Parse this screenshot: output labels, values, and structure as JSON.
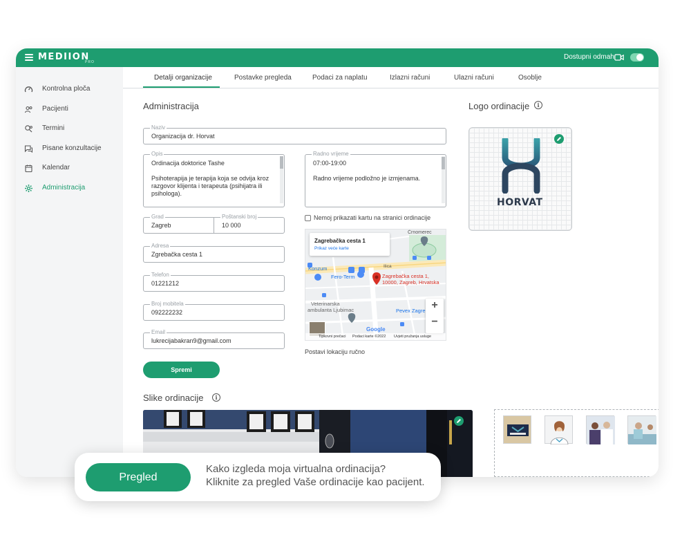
{
  "app": {
    "brand": "MEDIION",
    "brand_sub": "PRO",
    "availability_label": "Dostupni odmah",
    "availability_on": true,
    "accent_color": "#1e9d70"
  },
  "sidebar": {
    "items": [
      {
        "label": "Kontrolna ploča",
        "icon": "dashboard-icon"
      },
      {
        "label": "Pacijenti",
        "icon": "patients-icon"
      },
      {
        "label": "Termini",
        "icon": "appointments-icon"
      },
      {
        "label": "Pisane konzultacije",
        "icon": "chat-icon"
      },
      {
        "label": "Kalendar",
        "icon": "calendar-icon"
      },
      {
        "label": "Administracija",
        "icon": "gear-icon",
        "active": true
      }
    ]
  },
  "tabs": [
    {
      "label": "Detalji organizacije",
      "active": true
    },
    {
      "label": "Postavke pregleda"
    },
    {
      "label": "Podaci za naplatu"
    },
    {
      "label": "Izlazni računi"
    },
    {
      "label": "Ulazni računi"
    },
    {
      "label": "Osoblje"
    }
  ],
  "admin": {
    "title": "Administracija",
    "name": {
      "label": "Naziv",
      "value": "Organizacija dr. Horvat"
    },
    "description": {
      "label": "Opis",
      "line1": "Ordinacija doktorice Tashe",
      "line2": "Psihoterapija je terapija koja se odvija kroz razgovor klijenta i terapeuta (psihijatra ili psihologa)."
    },
    "hours": {
      "label": "Radno vrijeme",
      "line1": "07:00-19:00",
      "line2": "Radno vrijeme podložno je izmjenama."
    },
    "city": {
      "label": "Grad",
      "value": "Zagreb"
    },
    "postal": {
      "label": "Poštanski broj",
      "value": "10 000"
    },
    "address": {
      "label": "Adresa",
      "value": "Zgrebačka cesta 1"
    },
    "phone": {
      "label": "Telefon",
      "value": "01221212"
    },
    "mobile": {
      "label": "Broj mobitela",
      "value": "092222232"
    },
    "email": {
      "label": "Email",
      "value": "lukrecijabakran9@gmail.com"
    },
    "hide_map_label": "Nemoj prikazati kartu na stranici ordinacije",
    "hide_map_checked": false,
    "save_label": "Spremi",
    "set_location_label": "Postavi lokaciju ručno"
  },
  "map": {
    "card_address": "Zagrebačka cesta 1",
    "card_link": "Prikaz veće karte",
    "pin_line1": "Zagrebačka cesta 1,",
    "pin_line2": "10000, Zagreb, Hrvatska",
    "places": [
      "Konzum",
      "Fero-Term",
      "Veterinarska",
      "ambulanta Ljubimac",
      "Pevex Zagreb",
      "Črnomerec",
      "Ilica"
    ],
    "zoom_in": "+",
    "zoom_out": "−",
    "footer": [
      "Tipkovni prečaci",
      "Podaci karte ©2022",
      "Uvjeti pružanja usluge"
    ],
    "google": "Google"
  },
  "logo": {
    "title": "Logo ordinacije",
    "wordmark": "HORVAT"
  },
  "photos": {
    "title": "Slike ordinacije"
  },
  "promo": {
    "button": "Pregled",
    "line1": "Kako izgleda moja virtualna ordinacija?",
    "line2": "Kliknite za pregled Vaše ordinacije kao pacijent."
  }
}
